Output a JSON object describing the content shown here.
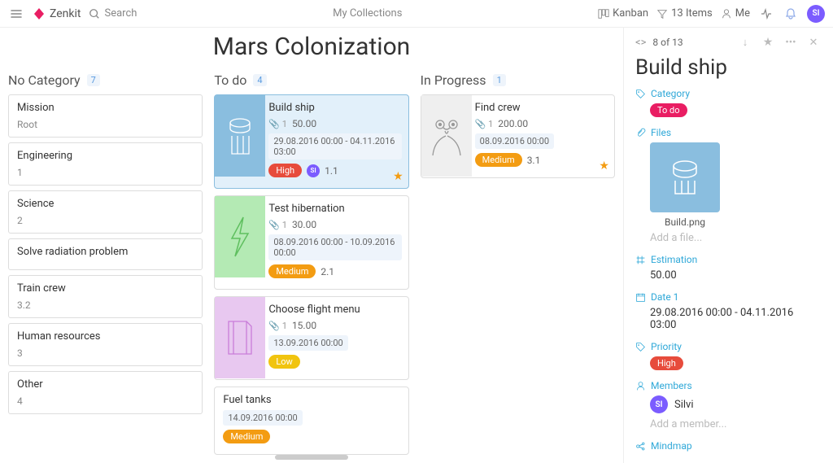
{
  "topbar": {
    "brand": "Zenkit",
    "search": "Search",
    "center": "My Collections",
    "view": "Kanban",
    "items_count": "13 Items",
    "user": "Me",
    "avatar": "SI"
  },
  "board": {
    "title": "Mars Colonization"
  },
  "columns": {
    "nocat": {
      "label": "No Category",
      "count": "7",
      "cards": [
        {
          "title": "Mission",
          "meta": "Root"
        },
        {
          "title": "Engineering",
          "meta": "1"
        },
        {
          "title": "Science",
          "meta": "2"
        },
        {
          "title": "Solve radiation problem",
          "meta": ""
        },
        {
          "title": "Train crew",
          "meta": "3.2"
        },
        {
          "title": "Human resources",
          "meta": "3"
        },
        {
          "title": "Other",
          "meta": "4"
        }
      ]
    },
    "todo": {
      "label": "To do",
      "count": "4",
      "cards": [
        {
          "title": "Build ship",
          "attach": "1",
          "est": "50.00",
          "dates": "29.08.2016 00:00 - 04.11.2016 03:00",
          "priority": "High",
          "priority_class": "badge-high",
          "pos": "1.1",
          "avatar": "SI",
          "starred": true,
          "thumb": "ship",
          "thumb_bg": "#8abedf"
        },
        {
          "title": "Test hibernation",
          "attach": "1",
          "est": "30.00",
          "dates": "08.09.2016 00:00 - 10.09.2016 00:00",
          "priority": "Medium",
          "priority_class": "badge-medium",
          "pos": "2.1",
          "thumb": "bolt",
          "thumb_bg": "#b4eab4"
        },
        {
          "title": "Choose flight menu",
          "attach": "1",
          "est": "15.00",
          "dates": "13.09.2016 00:00",
          "priority": "Low",
          "priority_class": "badge-low",
          "thumb": "menu",
          "thumb_bg": "#e8c8f0"
        },
        {
          "title": "Fuel tanks",
          "dates": "14.09.2016 00:00",
          "priority": "Medium",
          "priority_class": "badge-medium"
        }
      ]
    },
    "inprog": {
      "label": "In Progress",
      "count": "1",
      "cards": [
        {
          "title": "Find crew",
          "attach": "1",
          "est": "200.00",
          "dates": "08.09.2016 00:00",
          "priority": "Medium",
          "priority_class": "badge-medium",
          "pos": "3.1",
          "starred": true,
          "thumb": "alien",
          "thumb_bg": "#efefef"
        }
      ]
    }
  },
  "side": {
    "position": "8 of 13",
    "title": "Build ship",
    "category_label": "Category",
    "category_value": "To do",
    "files_label": "Files",
    "file_name": "Build.png",
    "add_file": "Add a file...",
    "estimation_label": "Estimation",
    "estimation_value": "50.00",
    "date_label": "Date 1",
    "date_value": "29.08.2016 00:00 - 04.11.2016 03:00",
    "priority_label": "Priority",
    "priority_value": "High",
    "members_label": "Members",
    "member_name": "Silvi",
    "member_avatar": "SI",
    "add_member": "Add a member...",
    "mindmap_label": "Mindmap"
  }
}
